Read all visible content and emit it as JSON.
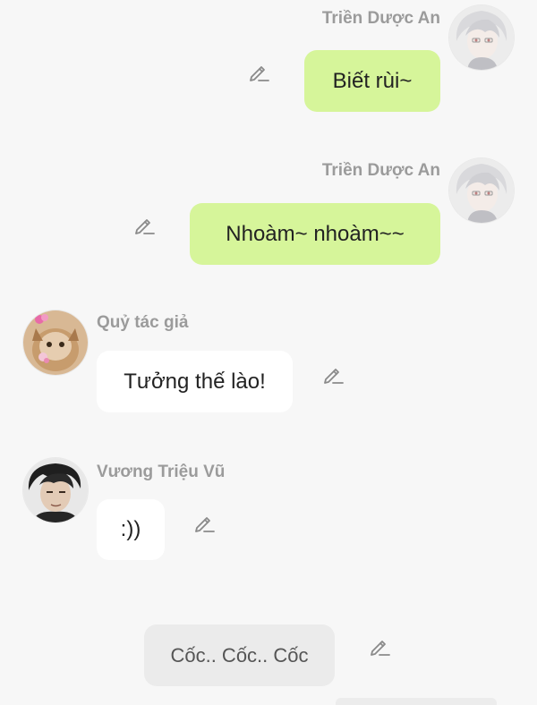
{
  "messages": [
    {
      "sender": "Triền Dược An",
      "text": "Biết rùi~",
      "side": "right",
      "avatar": "white-haired-boy-avatar"
    },
    {
      "sender": "Triền Dược An",
      "text": "Nhoàm~ nhoàm~~",
      "side": "right",
      "avatar": "white-haired-boy-avatar"
    },
    {
      "sender": "Quỷ tác giả",
      "text": "Tưởng thế lào!",
      "side": "left",
      "avatar": "cat-avatar"
    },
    {
      "sender": "Vương Triệu Vũ",
      "text": ":))",
      "side": "left",
      "avatar": "dark-haired-man-avatar"
    },
    {
      "sender": "",
      "text": "Cốc.. Cốc.. Cốc",
      "side": "center",
      "avatar": ""
    }
  ],
  "icons": {
    "edit": "pencil-edit-icon"
  },
  "colors": {
    "background": "#f7f7f7",
    "my_bubble": "#d6f59a",
    "other_bubble": "#ffffff",
    "narration_bubble": "#ebebeb",
    "sender_name": "#9b9b9b"
  }
}
